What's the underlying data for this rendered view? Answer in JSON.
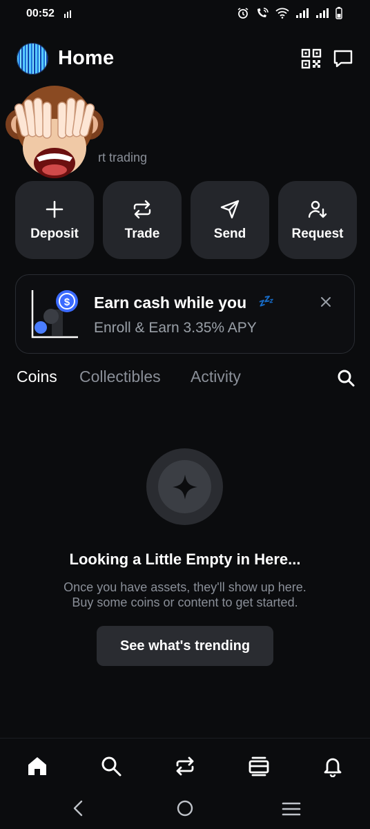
{
  "status_bar": {
    "time": "00:52"
  },
  "header": {
    "title": "Home"
  },
  "balance": {
    "subtitle": "rt trading"
  },
  "actions": [
    {
      "label": "Deposit",
      "icon": "plus-icon"
    },
    {
      "label": "Trade",
      "icon": "swap-icon"
    },
    {
      "label": "Send",
      "icon": "send-icon"
    },
    {
      "label": "Request",
      "icon": "request-icon"
    }
  ],
  "promo": {
    "title": "Earn cash while you",
    "title_emoji": "💤",
    "subtitle": "Enroll & Earn 3.35% APY"
  },
  "tabs": {
    "coins": "Coins",
    "collectibles": "Collectibles",
    "activity": "Activity"
  },
  "empty_state": {
    "title": "Looking a Little Empty in Here...",
    "line1": "Once you have assets, they'll show up here.",
    "line2": "Buy some coins or content to get started.",
    "button": "See what's trending"
  },
  "colors": {
    "background": "#0b0c0e",
    "card": "#24262b",
    "accent": "#3b6bff",
    "muted_text": "#8a8f98"
  }
}
